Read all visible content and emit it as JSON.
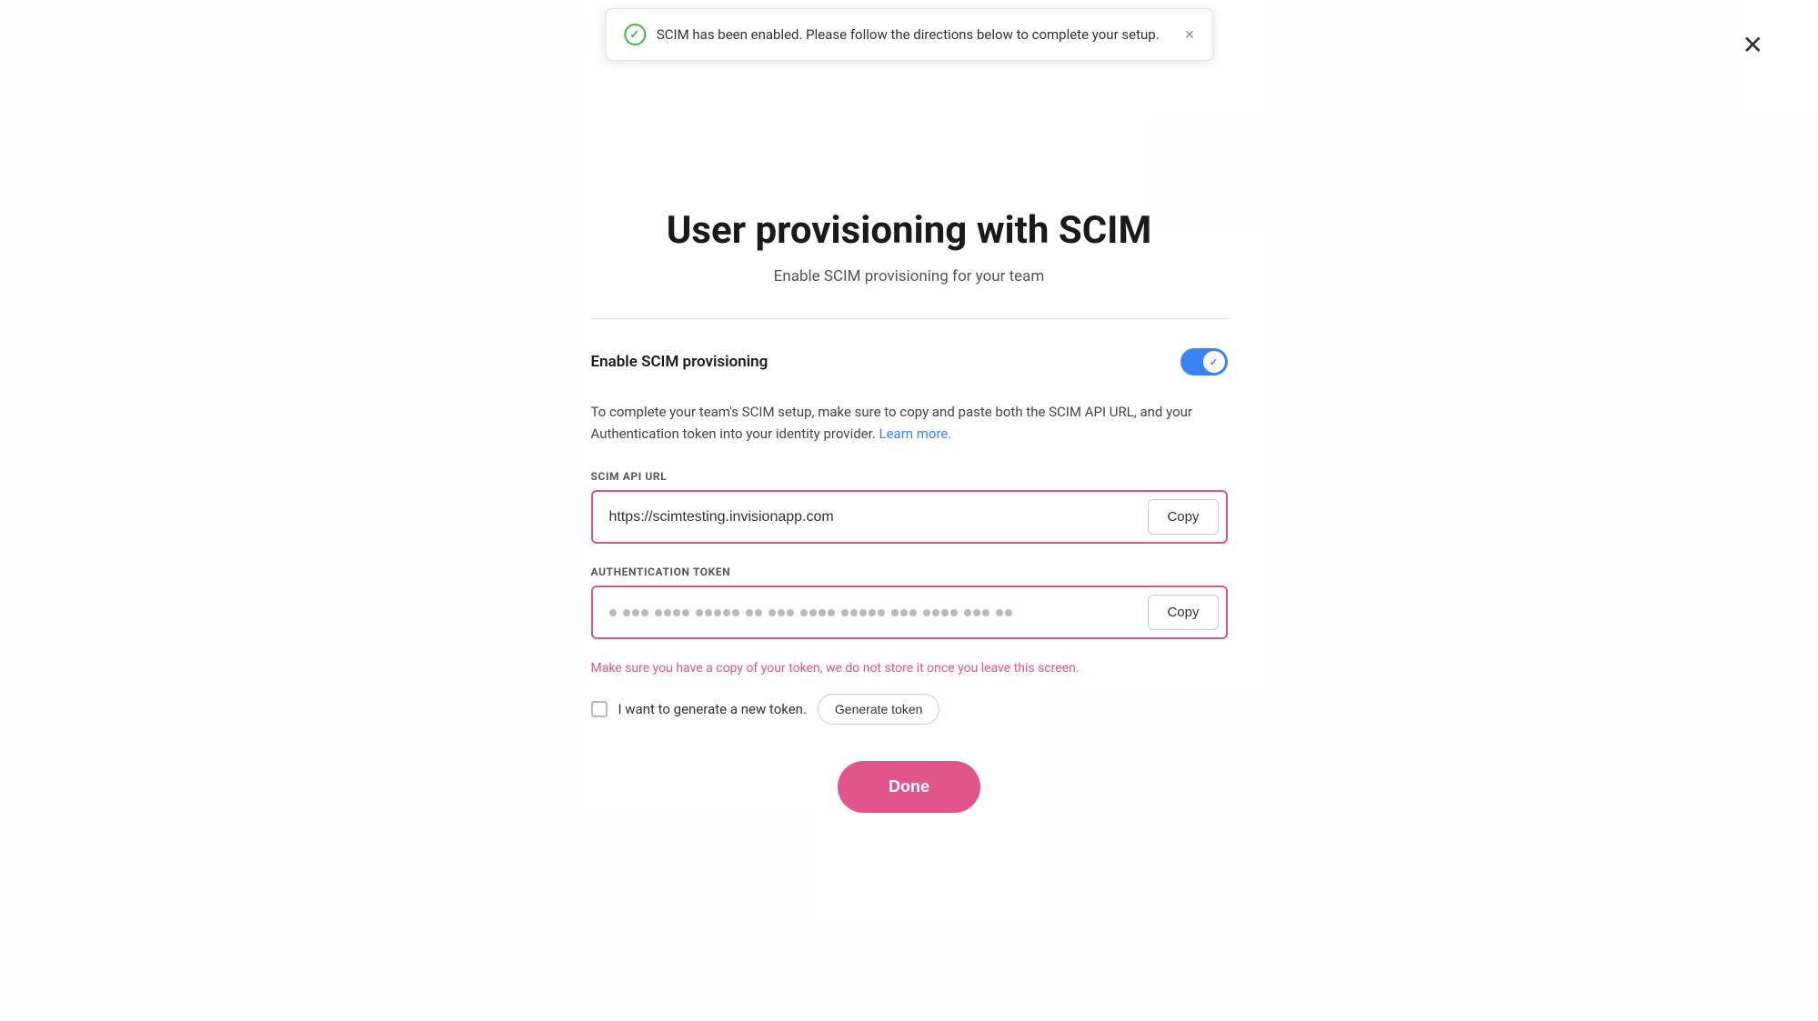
{
  "modal": {
    "close_label": "✕"
  },
  "toast": {
    "message": "SCIM has been enabled. Please follow the directions below to complete your setup.",
    "close_label": "×",
    "check_icon": "check-circle-icon"
  },
  "page": {
    "title": "User provisioning with SCIM",
    "subtitle": "Enable SCIM provisioning for your team"
  },
  "toggle": {
    "label": "Enable SCIM provisioning",
    "enabled": true
  },
  "description": {
    "text_before_link": "To complete your team's SCIM setup, make sure to copy and paste both the SCIM API URL, and your Authentication token into your identity provider. ",
    "link_text": "Learn more.",
    "link_href": "#"
  },
  "scim_url_field": {
    "label": "SCIM API URL",
    "value": "https://scimtesting.invisionapp.com",
    "copy_button_label": "Copy"
  },
  "auth_token_field": {
    "label": "Authentication token",
    "copy_button_label": "Copy"
  },
  "warning_text": "Make sure you have a copy of your token, we do not store it once you leave this screen.",
  "generate_token": {
    "checkbox_label": "I want to generate a new token.",
    "button_label": "Generate token"
  },
  "done_button_label": "Done"
}
